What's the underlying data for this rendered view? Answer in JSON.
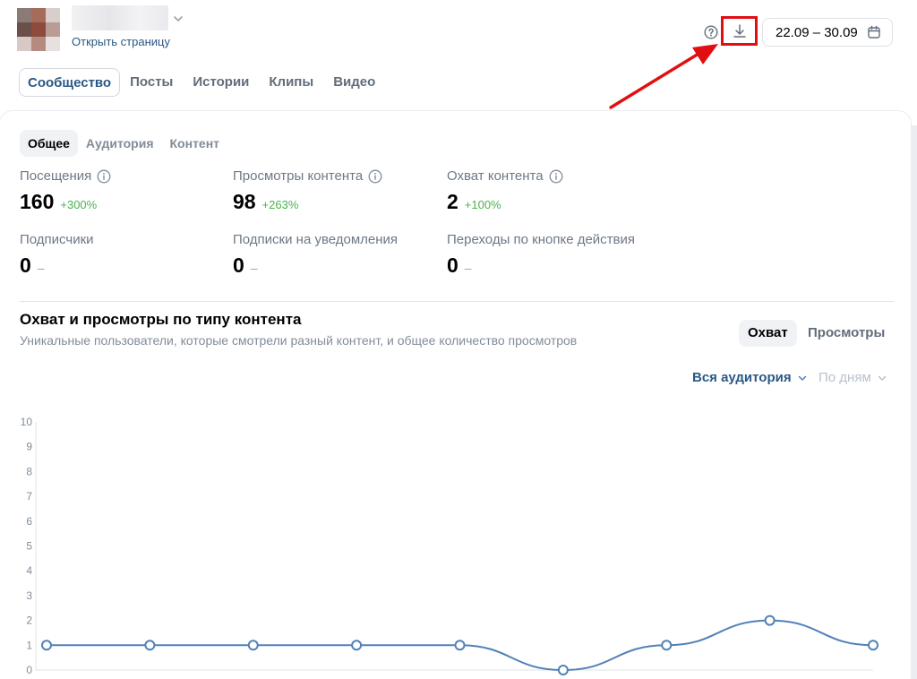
{
  "header": {
    "open_page_label": "Открыть страницу",
    "date_range": "22.09 – 30.09"
  },
  "main_tabs": [
    {
      "label": "Сообщество",
      "active": true
    },
    {
      "label": "Посты",
      "active": false
    },
    {
      "label": "Истории",
      "active": false
    },
    {
      "label": "Клипы",
      "active": false
    },
    {
      "label": "Видео",
      "active": false
    }
  ],
  "sub_tabs": [
    {
      "label": "Общее",
      "active": true
    },
    {
      "label": "Аудитория",
      "active": false
    },
    {
      "label": "Контент",
      "active": false
    }
  ],
  "metrics": [
    {
      "label": "Посещения",
      "value": "160",
      "delta": "+300%",
      "info": true
    },
    {
      "label": "Просмотры контента",
      "value": "98",
      "delta": "+263%",
      "info": true
    },
    {
      "label": "Охват контента",
      "value": "2",
      "delta": "+100%",
      "info": true
    },
    {
      "label": "Подписчики",
      "value": "0",
      "delta": "–",
      "info": false
    },
    {
      "label": "Подписки на уведомления",
      "value": "0",
      "delta": "–",
      "info": false
    },
    {
      "label": "Переходы по кнопке действия",
      "value": "0",
      "delta": "–",
      "info": false
    }
  ],
  "chart_section": {
    "title": "Охват и просмотры по типу контента",
    "subtitle": "Уникальные пользователи, которые смотрели разный контент, и общее количество просмотров",
    "segment_active": "Охват",
    "segment_inactive": "Просмотры",
    "filter_audience": "Вся аудитория",
    "filter_period": "По дням"
  },
  "colors": {
    "accent": "#2a5885",
    "line": "#5181b8",
    "positive": "#4bb34b",
    "highlight": "#e10f12"
  },
  "chart_data": {
    "type": "line",
    "x": [
      1,
      2,
      3,
      4,
      5,
      6,
      7,
      8,
      9
    ],
    "series": [
      {
        "values": [
          1,
          1,
          1,
          1,
          1,
          0,
          1,
          2,
          1
        ]
      }
    ],
    "yticks": [
      "0",
      "1",
      "2",
      "3",
      "4",
      "5",
      "6",
      "7",
      "8",
      "9",
      "10"
    ],
    "ylim": [
      0,
      10
    ],
    "grid": false,
    "smooth": true
  }
}
